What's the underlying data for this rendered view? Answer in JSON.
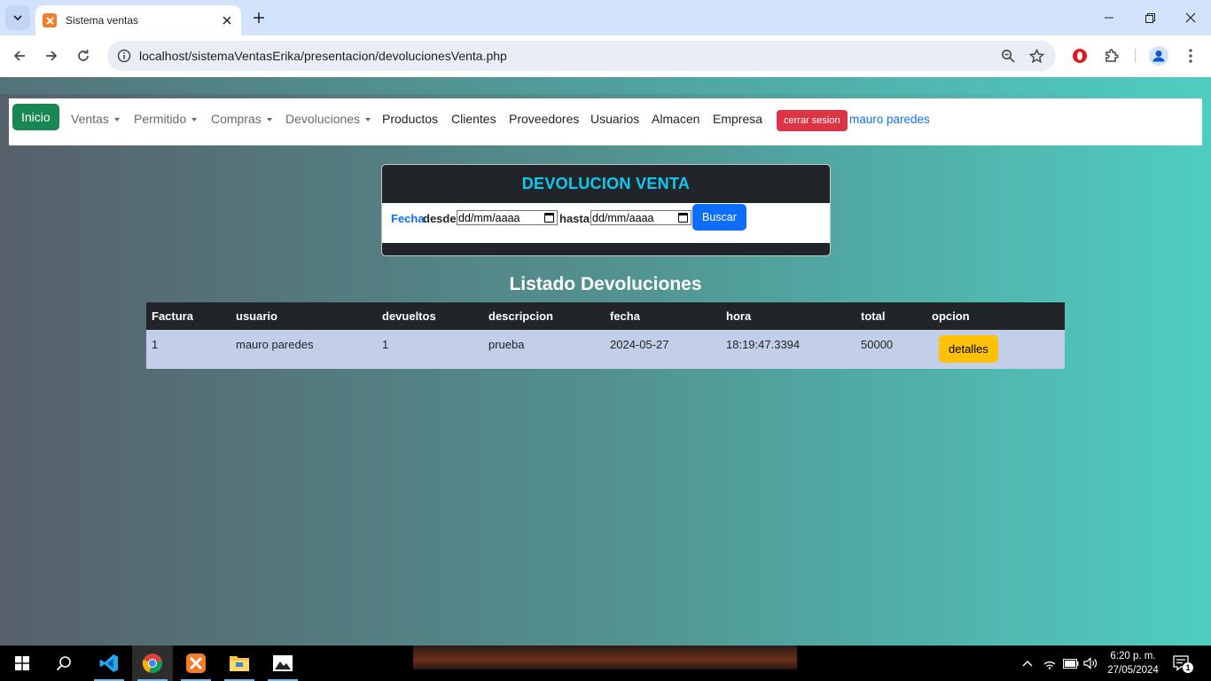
{
  "browser": {
    "tab_title": "Sistema ventas",
    "url": "localhost/sistemaVentasErika/presentacion/devolucionesVenta.php"
  },
  "navbar": {
    "home": "Inicio",
    "items": [
      {
        "label": "Ventas",
        "dropdown": true
      },
      {
        "label": "Permitido",
        "dropdown": true
      },
      {
        "label": "Compras",
        "dropdown": true
      },
      {
        "label": "Devoluciones",
        "dropdown": true
      },
      {
        "label": "Productos"
      },
      {
        "label": "Clientes"
      },
      {
        "label": "Proveedores"
      },
      {
        "label": "Usuarios"
      },
      {
        "label": "Almacen"
      },
      {
        "label": "Empresa"
      }
    ],
    "logout": "cerrar sesion",
    "user": "mauro paredes"
  },
  "filter_card": {
    "title": "DEVOLUCION VENTA",
    "label_fecha": "Fecha",
    "label_desde": "desde",
    "desde_placeholder": "dd/mm/aaaa",
    "label_hasta": "hasta",
    "hasta_placeholder": "dd/mm/aaaa",
    "search_button": "Buscar"
  },
  "list": {
    "title": "Listado Devoluciones",
    "columns": [
      "Factura",
      "usuario",
      "devueltos",
      "descripcion",
      "fecha",
      "hora",
      "total",
      "opcion"
    ],
    "rows": [
      {
        "factura": "1",
        "usuario": "mauro paredes",
        "devueltos": "1",
        "descripcion": "prueba",
        "fecha": "2024-05-27",
        "hora": "18:19:47.3394",
        "total": "50000",
        "opcion": "detalles"
      }
    ]
  },
  "taskbar": {
    "time": "6:20 p. m.",
    "date": "27/05/2024",
    "notification_count": "1"
  },
  "colors": {
    "inicio": "#198754",
    "logout": "#dc3545",
    "buscar": "#0d6efd",
    "detalles": "#ffc107",
    "card_title": "#0dcaf0",
    "table_row": "#c3cfe9"
  }
}
